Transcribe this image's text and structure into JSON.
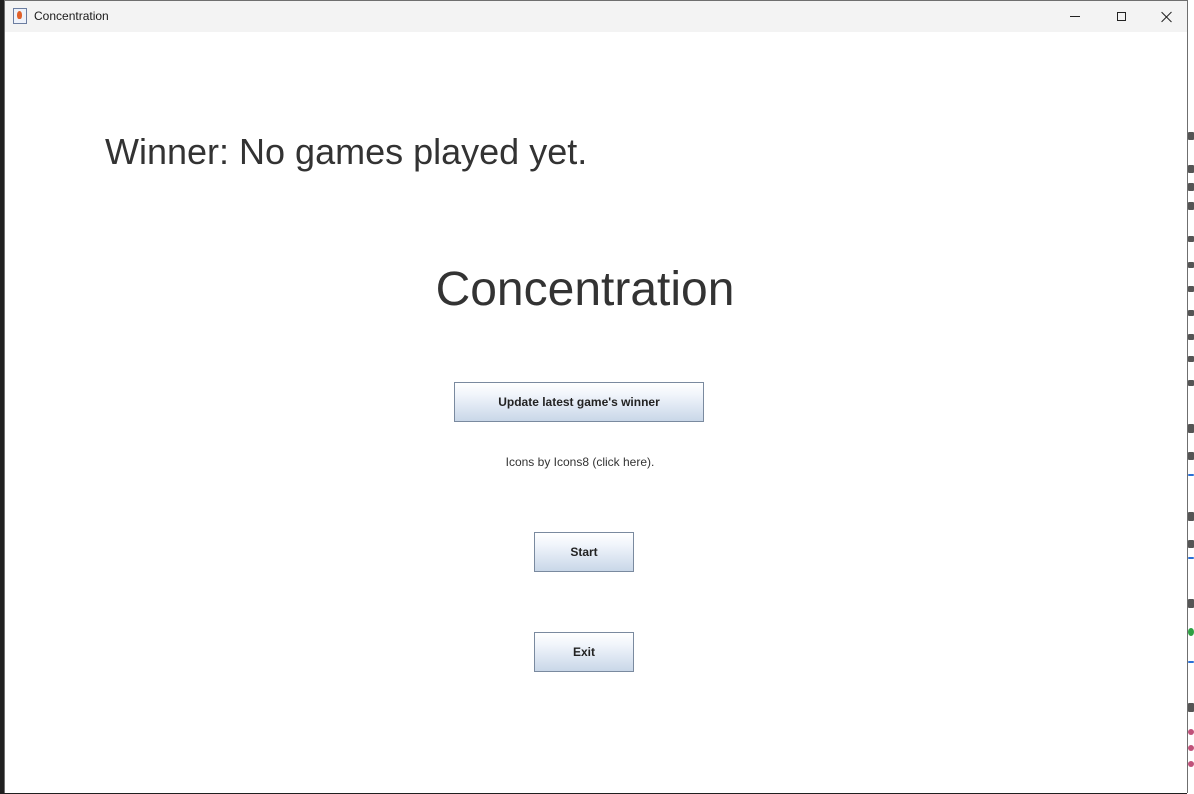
{
  "window": {
    "title": "Concentration"
  },
  "main": {
    "winner_text": "Winner: No games played yet.",
    "title": "Concentration",
    "update_button_label": "Update latest game's winner",
    "icons_credit": "Icons by Icons8 (click here).",
    "start_button_label": "Start",
    "exit_button_label": "Exit"
  }
}
